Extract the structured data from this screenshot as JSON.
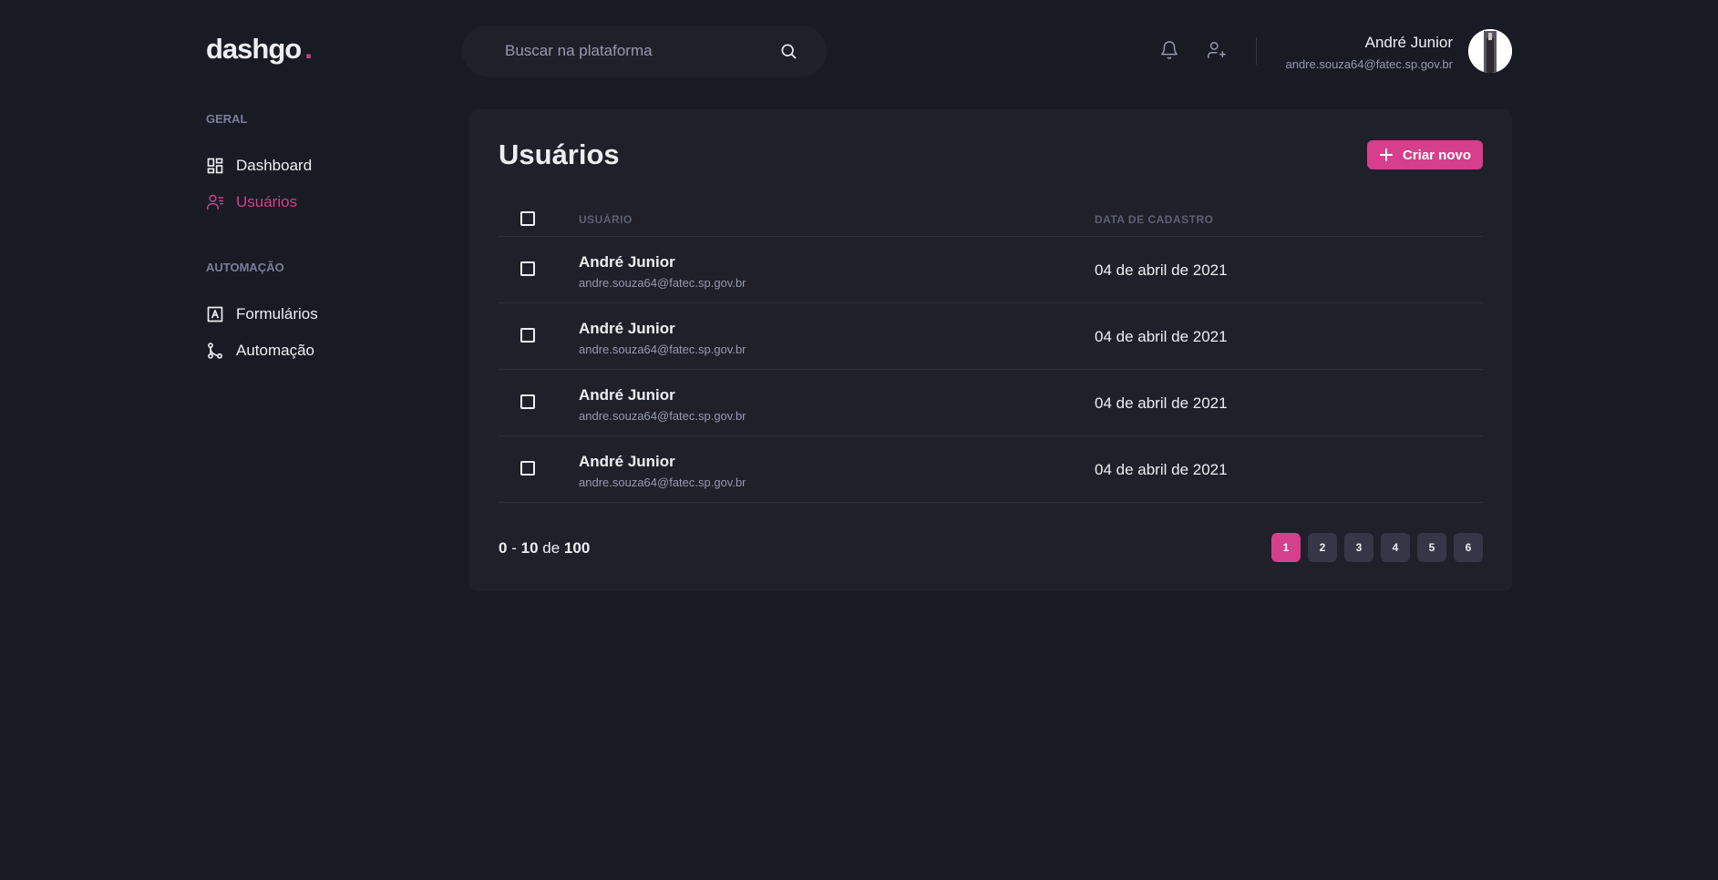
{
  "header": {
    "logo_text": "dashgo",
    "logo_dot": ".",
    "search_placeholder": "Buscar na plataforma",
    "user_name": "André Junior",
    "user_email": "andre.souza64@fatec.sp.gov.br"
  },
  "sidebar": {
    "sections": [
      {
        "title": "GERAL",
        "items": [
          {
            "label": "Dashboard",
            "icon": "dashboard-icon"
          },
          {
            "label": "Usuários",
            "icon": "users-icon",
            "active": true
          }
        ]
      },
      {
        "title": "AUTOMAÇÃO",
        "items": [
          {
            "label": "Formulários",
            "icon": "form-icon"
          },
          {
            "label": "Automação",
            "icon": "git-branch-icon"
          }
        ]
      }
    ]
  },
  "main": {
    "title": "Usuários",
    "create_button": "Criar novo",
    "columns": {
      "user": "USUÁRIO",
      "date": "DATA DE CADASTRO"
    },
    "rows": [
      {
        "name": "André Junior",
        "email": "andre.souza64@fatec.sp.gov.br",
        "date": "04 de abril de 2021"
      },
      {
        "name": "André Junior",
        "email": "andre.souza64@fatec.sp.gov.br",
        "date": "04 de abril de 2021"
      },
      {
        "name": "André Junior",
        "email": "andre.souza64@fatec.sp.gov.br",
        "date": "04 de abril de 2021"
      },
      {
        "name": "André Junior",
        "email": "andre.souza64@fatec.sp.gov.br",
        "date": "04 de abril de 2021"
      }
    ],
    "pagination": {
      "from": "0",
      "separator": "-",
      "to": "10",
      "of_label": "de",
      "total": "100",
      "pages": [
        "1",
        "2",
        "3",
        "4",
        "5",
        "6"
      ],
      "current_page": "1"
    }
  },
  "colors": {
    "accent": "#d53f8c",
    "background": "#181b23",
    "card": "#1f2029"
  }
}
